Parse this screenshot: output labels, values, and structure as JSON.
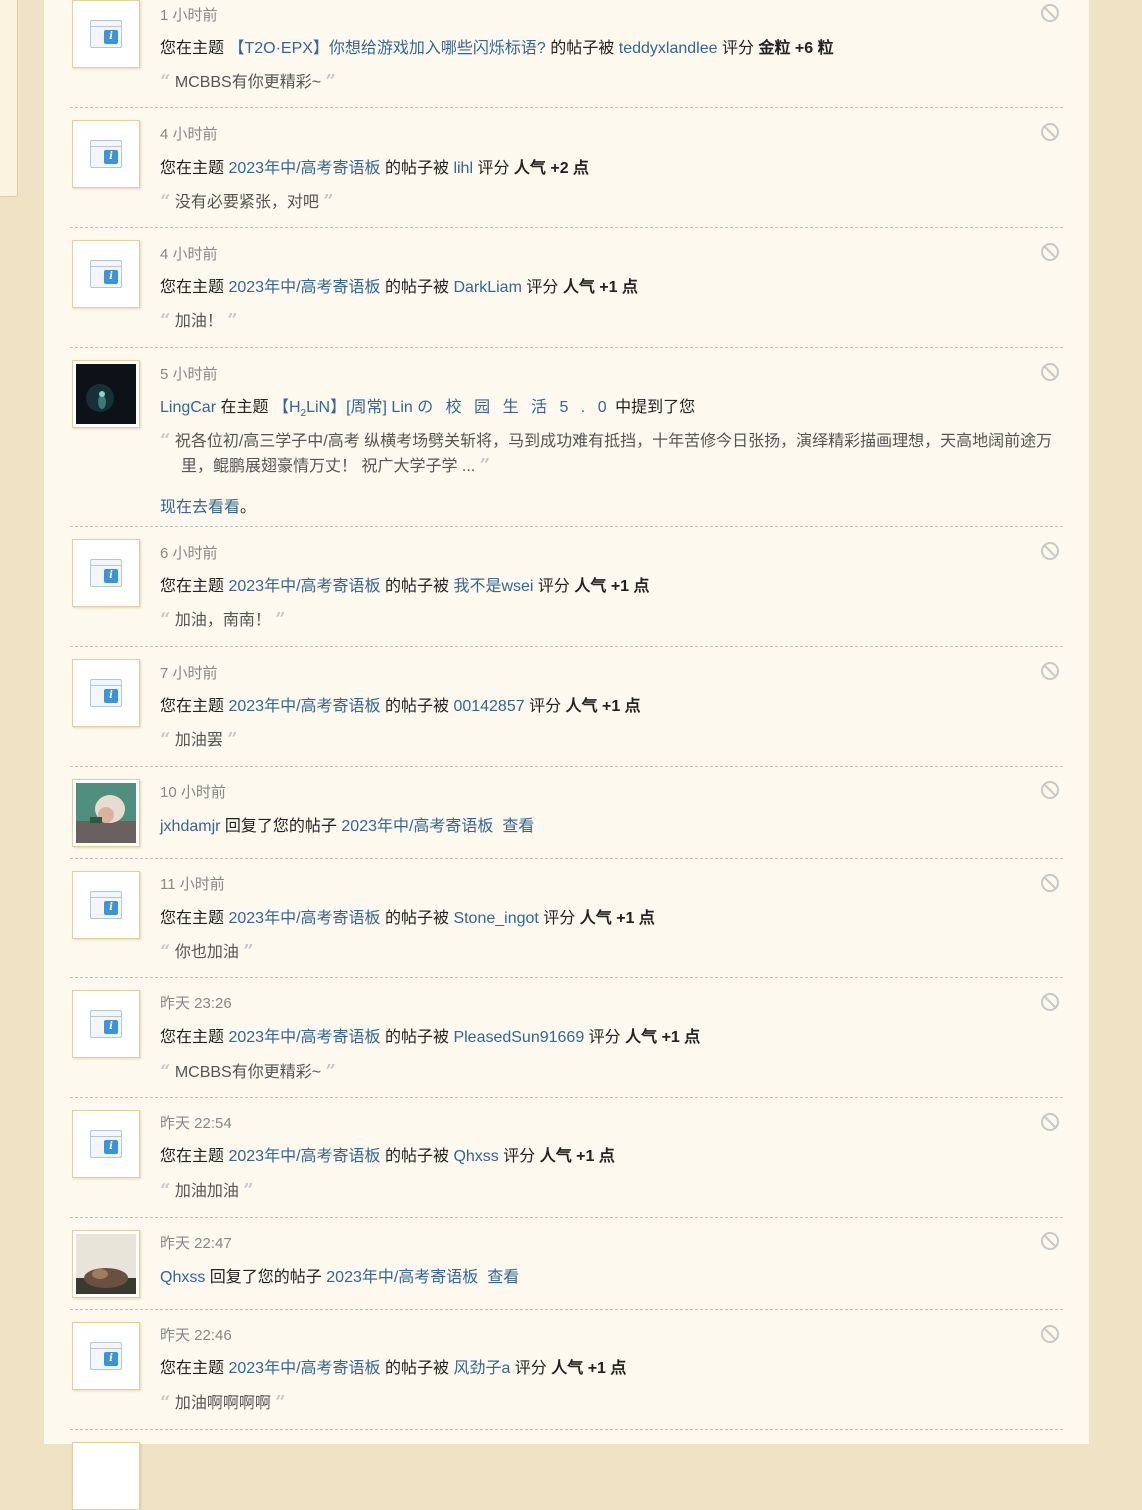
{
  "items": [
    {
      "type": "rate",
      "time": "1 小时前",
      "prefix": "您在主题",
      "thread": "【T2O·EPX】你想给游戏加入哪些闪烁标语?",
      "mid": "的帖子被",
      "user": "teddyxlandlee",
      "action": "评分",
      "value": "金粒 +6 粒",
      "quote": "MCBBS有你更精彩~"
    },
    {
      "type": "rate",
      "time": "4 小时前",
      "prefix": "您在主题",
      "thread": "2023年中/高考寄语板",
      "mid": "的帖子被",
      "user": "lihl",
      "action": "评分",
      "value": "人气 +2 点",
      "quote": "没有必要紧张，对吧"
    },
    {
      "type": "rate",
      "time": "4 小时前",
      "prefix": "您在主题",
      "thread": "2023年中/高考寄语板",
      "mid": "的帖子被",
      "user": "DarkLiam",
      "action": "评分",
      "value": "人气 +1 点",
      "quote": "加油！"
    },
    {
      "type": "mention",
      "time": "5 小时前",
      "user": "LingCar",
      "pre": "在主题",
      "thread_a": "【H",
      "thread_sub": "2",
      "thread_b": "LiN】[周常] Lin",
      "thread_c": "の 校 园 生 活 5 . 0",
      "post": "中提到了您",
      "quote": "祝各位初/高三学子中/高考 纵横考场劈关斩将，马到成功难有抵挡，十年苦修今日张扬，演绎精彩描画理想，天高地阔前途万里，鲲鹏展翅豪情万丈！ 祝广大学子学 ...",
      "golink": "现在去看看",
      "golink_suffix": "。"
    },
    {
      "type": "rate",
      "time": "6 小时前",
      "prefix": "您在主题",
      "thread": "2023年中/高考寄语板",
      "mid": "的帖子被",
      "user": "我不是wsei",
      "action": "评分",
      "value": "人气 +1 点",
      "quote": "加油，南南！"
    },
    {
      "type": "rate",
      "time": "7 小时前",
      "prefix": "您在主题",
      "thread": "2023年中/高考寄语板",
      "mid": "的帖子被",
      "user": "00142857",
      "action": "评分",
      "value": "人气 +1 点",
      "quote": "加油罢"
    },
    {
      "type": "reply",
      "time": "10 小时前",
      "user": "jxhdamjr",
      "text": "回复了您的帖子",
      "thread": "2023年中/高考寄语板",
      "view": "查看"
    },
    {
      "type": "rate",
      "time": "11 小时前",
      "prefix": "您在主题",
      "thread": "2023年中/高考寄语板",
      "mid": "的帖子被",
      "user": "Stone_ingot",
      "action": "评分",
      "value": "人气 +1 点",
      "quote": "你也加油"
    },
    {
      "type": "rate",
      "time": "昨天 23:26",
      "prefix": "您在主题",
      "thread": "2023年中/高考寄语板",
      "mid": "的帖子被",
      "user": "PleasedSun91669",
      "action": "评分",
      "value": "人气 +1 点",
      "quote": "MCBBS有你更精彩~"
    },
    {
      "type": "rate",
      "time": "昨天 22:54",
      "prefix": "您在主题",
      "thread": "2023年中/高考寄语板",
      "mid": "的帖子被",
      "user": "Qhxss",
      "action": "评分",
      "value": "人气 +1 点",
      "quote": "加油加油"
    },
    {
      "type": "reply",
      "time": "昨天 22:47",
      "user": "Qhxss",
      "text": "回复了您的帖子",
      "thread": "2023年中/高考寄语板",
      "view": "查看"
    },
    {
      "type": "rate",
      "time": "昨天 22:46",
      "prefix": "您在主题",
      "thread": "2023年中/高考寄语板",
      "mid": "的帖子被",
      "user": "风劲子a",
      "action": "评分",
      "value": "人气 +1 点",
      "quote": "加油啊啊啊啊"
    }
  ]
}
